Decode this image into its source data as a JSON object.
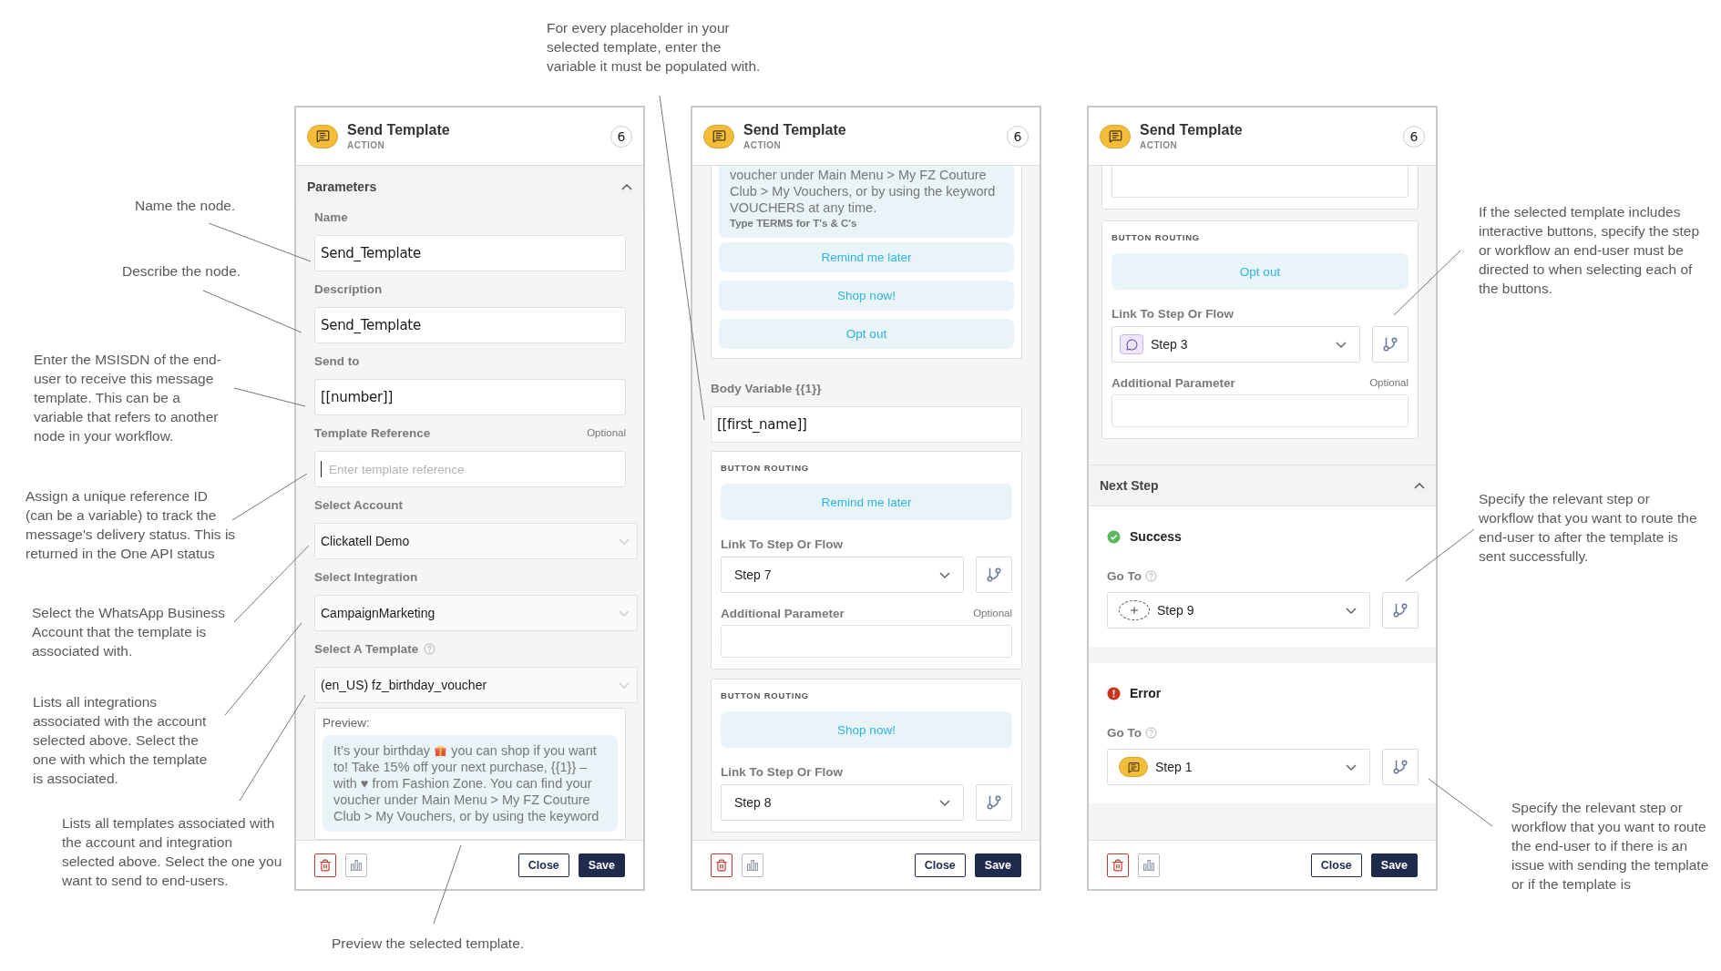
{
  "annotations": [
    "Name the node.",
    "Describe the node.",
    "Enter the MSISDN of the end-user to receive this message template. This can be a variable that refers to another node in your workflow.",
    "Assign a unique reference ID (can be a variable) to track the message's delivery status. This is returned in the One API status",
    "Select the WhatsApp Business Account that the template is associated with.",
    "Lists all integrations associated with the account selected above. Select the one with which the template is associated.",
    "Lists all templates associated with the account and integration selected above. Select the one you want to send to end-users.",
    "Preview the selected template.",
    "For every placeholder in your selected template, enter the variable it must be populated with.",
    "If the selected template includes interactive buttons, specify the step or workflow an end-user must be directed to when selecting each of the buttons.",
    "Specify the relevant step or workflow that you want to route the end-user to after the template is sent successfully.",
    "Specify the relevant step or workflow that you want to route the end-user to if there is an issue with sending the template or if the template is"
  ],
  "panels": [
    {
      "header": {
        "title": "Send Template",
        "subtitle": "ACTION",
        "badge": "6"
      },
      "items": [
        {
          "kind": "section",
          "label": "Parameters",
          "expanded": true
        },
        {
          "kind": "input",
          "label": "Name",
          "value": "Send_Template"
        },
        {
          "kind": "input",
          "label": "Description",
          "value": "Send_Template"
        },
        {
          "kind": "input",
          "label": "Send to",
          "value": "[[number]]"
        },
        {
          "kind": "input",
          "label": "Template Reference",
          "note": "Optional",
          "placeholder": "Enter template reference",
          "focused": true
        },
        {
          "kind": "select",
          "label": "Select Account",
          "value": "Clickatell Demo"
        },
        {
          "kind": "select",
          "label": "Select Integration",
          "value": "CampaignMarketing"
        },
        {
          "kind": "select",
          "label": "Select A Template",
          "help": true,
          "value": "(en_US) fz_birthday_voucher"
        },
        {
          "kind": "preview",
          "label": "Preview:",
          "text_before_icon": "It’s your birthday",
          "text_after_icon": "you can shop if you want",
          "text": "to! Take 15% off your next purchase, {{1}} – with ♥ from Fashion Zone. You can find your voucher under Main Menu > My FZ Couture Club > My Vouchers, or by using the keyword"
        }
      ],
      "footer": {
        "close": "Close",
        "save": "Save"
      }
    },
    {
      "header": {
        "title": "Send Template",
        "subtitle": "ACTION",
        "badge": "6"
      },
      "items": [
        {
          "kind": "preview_continued",
          "text": "voucher under Main Menu > My FZ Couture Club > My Vouchers, or by using the keyword VOUCHERS at any time.",
          "footer": "Type TERMS for T's & C's",
          "buttons": [
            "Remind me later",
            "Shop now!",
            "Opt out"
          ]
        },
        {
          "kind": "input",
          "label": "Body Variable {{1}}",
          "value": "[[first_name]]"
        },
        {
          "kind": "routing",
          "heading": "BUTTON ROUTING",
          "button": "Remind me later",
          "link_label": "Link To Step Or Flow",
          "step": {
            "kind": "plain",
            "label": "Step 7"
          },
          "param_label": "Additional Parameter",
          "param_note": "Optional"
        },
        {
          "kind": "routing",
          "heading": "BUTTON ROUTING",
          "button": "Shop now!",
          "link_label": "Link To Step Or Flow",
          "step": {
            "kind": "plain",
            "label": "Step 8"
          }
        }
      ],
      "footer": {
        "close": "Close",
        "save": "Save"
      }
    },
    {
      "header": {
        "title": "Send Template",
        "subtitle": "ACTION",
        "badge": "6"
      },
      "items": [
        {
          "kind": "input_tail"
        },
        {
          "kind": "routing",
          "heading": "BUTTON ROUTING",
          "button": "Opt out",
          "link_label": "Link To Step Or Flow",
          "step": {
            "kind": "chat",
            "label": "Step 3"
          },
          "param_label": "Additional Parameter",
          "param_note": "Optional"
        },
        {
          "kind": "section",
          "label": "Next Step",
          "expanded": true
        },
        {
          "kind": "outcome",
          "status": {
            "kind": "success",
            "label": "Success"
          },
          "goto_label": "Go To",
          "help": true,
          "step": {
            "kind": "new",
            "label": "Step 9"
          }
        },
        {
          "kind": "outcome",
          "status": {
            "kind": "error",
            "label": "Error"
          },
          "goto_label": "Go To",
          "help": true,
          "step": {
            "kind": "message",
            "label": "Step 1"
          }
        }
      ],
      "footer": {
        "close": "Close",
        "save": "Save"
      }
    }
  ]
}
